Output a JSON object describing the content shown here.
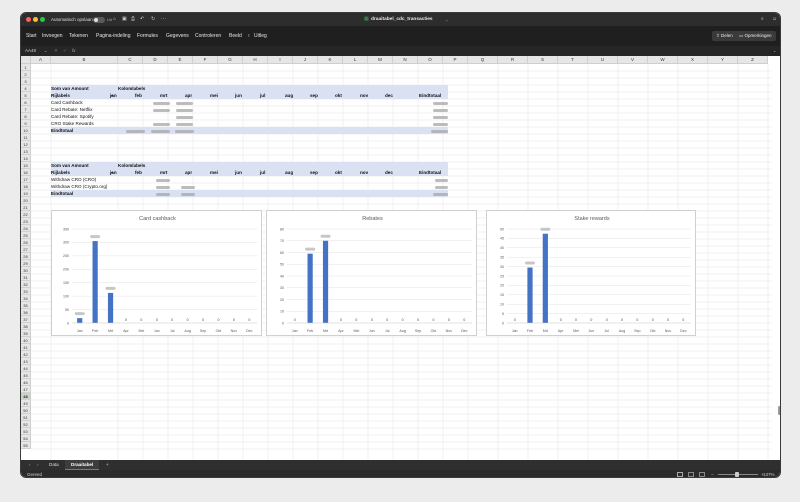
{
  "window": {
    "autosave_label": "Automatisch opslaan",
    "autosave_state": "Uit",
    "title": "draaitabel_cdc_transacties"
  },
  "ribbon": {
    "tabs": [
      "Start",
      "Invoegen",
      "Tekenen",
      "Pagina-indeling",
      "Formules",
      "Gegevens",
      "Controleren",
      "Beeld",
      "Uitleg"
    ],
    "share_label": "Delen",
    "comments_label": "Opmerkingen"
  },
  "formula_bar": {
    "cell_ref": "AA48",
    "fx": "fx",
    "value": ""
  },
  "columns": [
    "A",
    "B",
    "C",
    "D",
    "E",
    "F",
    "G",
    "H",
    "I",
    "J",
    "K",
    "L",
    "M",
    "N",
    "O",
    "P",
    "Q",
    "R",
    "S",
    "T",
    "U",
    "V",
    "W",
    "X",
    "Y",
    "Z"
  ],
  "rows": [
    "1",
    "2",
    "3",
    "4",
    "5",
    "6",
    "7",
    "8",
    "9",
    "10",
    "11",
    "12",
    "13",
    "14",
    "15",
    "16",
    "17",
    "18",
    "19",
    "20",
    "21",
    "22",
    "23",
    "24",
    "25",
    "26",
    "27",
    "28",
    "29",
    "30",
    "31",
    "32",
    "33",
    "34",
    "35",
    "36",
    "37",
    "38",
    "39",
    "40",
    "41",
    "42",
    "43",
    "44",
    "45",
    "46",
    "47",
    "48",
    "49",
    "50",
    "51",
    "52",
    "53",
    "54",
    "55"
  ],
  "pivot1": {
    "value_label": "Som van Amount",
    "col_label": "Kolomlabels",
    "row_label": "Rijlabels",
    "months": [
      "jan",
      "feb",
      "mrt",
      "apr",
      "mei",
      "jun",
      "jul",
      "aug",
      "sep",
      "okt",
      "nov",
      "dec"
    ],
    "total_label": "Eindtotaal",
    "rows": [
      "Card Cashback",
      "Card Rebate: Netflix",
      "Card Rebate: Spotify",
      "CRO Stake Rewards"
    ],
    "grand_total_label": "Eindtotaal"
  },
  "pivot2": {
    "value_label": "Som van Amount",
    "col_label": "Kolomlabels",
    "row_label": "Rijlabels",
    "total_label": "Eindtotaal",
    "rows": [
      "Withdraw CRO (CRO)",
      "Withdraw CRO (Crypto.org)"
    ],
    "grand_total_label": "Eindtotaal"
  },
  "chart_data": [
    {
      "type": "bar",
      "title": "Card cashback",
      "categories": [
        "Jan",
        "Feb",
        "Mrt",
        "Apr",
        "Mei",
        "Jun",
        "Jul",
        "Aug",
        "Sep",
        "Okt",
        "Nov",
        "Dec"
      ],
      "values": [
        18,
        305,
        112,
        0,
        0,
        0,
        0,
        0,
        0,
        0,
        0,
        0
      ],
      "ylim": [
        0,
        350
      ],
      "yticks": [
        0,
        50,
        100,
        150,
        200,
        250,
        300,
        350
      ],
      "grid": true,
      "color": "#4472c4"
    },
    {
      "type": "bar",
      "title": "Rebates",
      "categories": [
        "Jan",
        "Feb",
        "Mrt",
        "Apr",
        "Mei",
        "Jun",
        "Jul",
        "Aug",
        "Sep",
        "Okt",
        "Nov",
        "Dec"
      ],
      "values": [
        0,
        59,
        70,
        0,
        0,
        0,
        0,
        0,
        0,
        0,
        0,
        0
      ],
      "ylim": [
        0,
        80
      ],
      "yticks": [
        0,
        10,
        20,
        30,
        40,
        50,
        60,
        70,
        80
      ],
      "grid": true,
      "color": "#4472c4"
    },
    {
      "type": "bar",
      "title": "Stake rewards",
      "categories": [
        "Jan",
        "Feb",
        "Mrt",
        "Apr",
        "Mei",
        "Jun",
        "Jul",
        "Aug",
        "Sep",
        "Okt",
        "Nov",
        "Dec"
      ],
      "values": [
        0,
        29.5,
        47.5,
        0,
        0,
        0,
        0,
        0,
        0,
        0,
        0,
        0
      ],
      "ylim": [
        0,
        50
      ],
      "yticks": [
        0,
        5,
        10,
        15,
        20,
        25,
        30,
        35,
        40,
        45,
        50
      ],
      "grid": true,
      "color": "#4472c4"
    }
  ],
  "sheets": {
    "tabs": [
      "Data",
      "Draaitabel"
    ],
    "active": "Draaitabel",
    "add": "+"
  },
  "status": {
    "left": "Gereed",
    "zoom": "137%"
  }
}
